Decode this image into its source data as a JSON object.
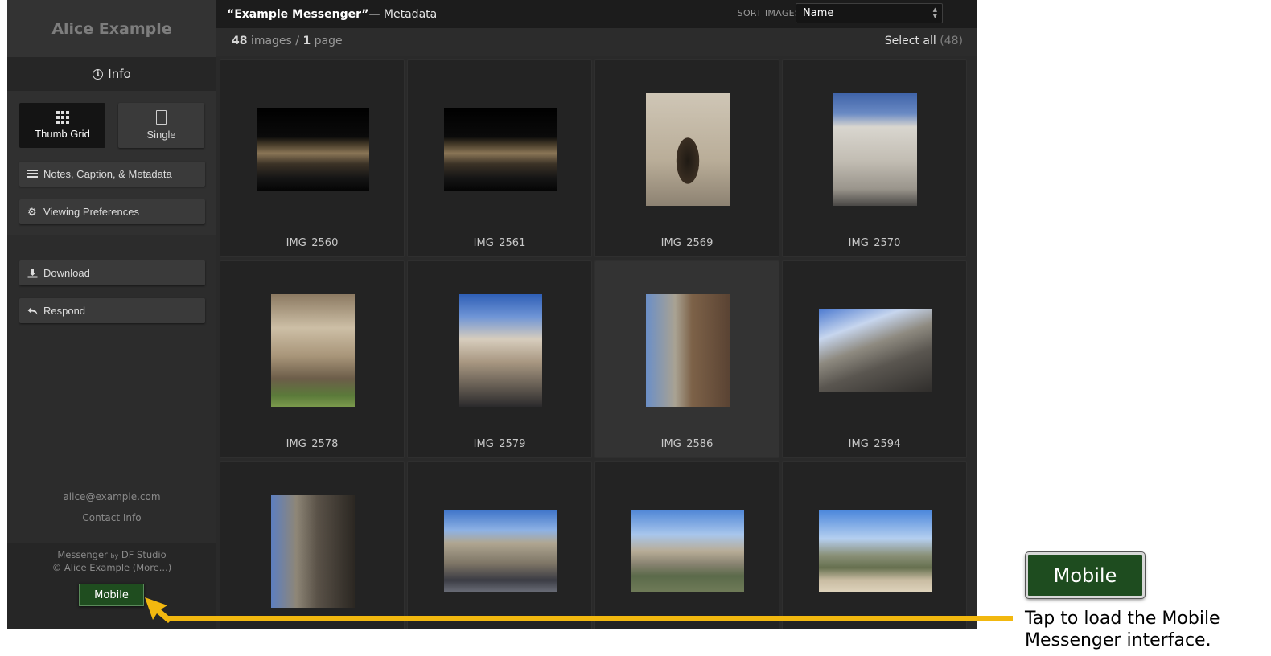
{
  "sidebar": {
    "owner_name": "Alice Example",
    "info_label": "Info",
    "view_thumb_label": "Thumb Grid",
    "view_single_label": "Single",
    "notes_label": "Notes, Caption, & Metadata",
    "prefs_label": "Viewing Preferences",
    "download_label": "Download",
    "respond_label": "Respond",
    "email": "alice@example.com",
    "contact_label": "Contact Info",
    "footer_app": "Messenger",
    "footer_by": "by",
    "footer_brand": "DF Studio",
    "footer_copyright": "© Alice Example (More...)",
    "mobile_label": "Mobile"
  },
  "header": {
    "title": "“Example Messenger”",
    "subtitle": " — Metadata",
    "sort_label": "SORT IMAGES :",
    "sort_value": "Name"
  },
  "counts": {
    "images": "48",
    "images_suffix": " images / ",
    "pages": "1",
    "pages_suffix": " page",
    "select_all": "Select all",
    "select_count": "(48)"
  },
  "images": [
    {
      "name": "IMG_2560"
    },
    {
      "name": "IMG_2561"
    },
    {
      "name": "IMG_2569"
    },
    {
      "name": "IMG_2570"
    },
    {
      "name": "IMG_2578"
    },
    {
      "name": "IMG_2579"
    },
    {
      "name": "IMG_2586"
    },
    {
      "name": "IMG_2594"
    },
    {
      "name": ""
    },
    {
      "name": ""
    },
    {
      "name": ""
    },
    {
      "name": ""
    }
  ],
  "callout": {
    "mobile_label": "Mobile",
    "text": "Tap to load the Mobile Messenger interface.",
    "arrow_color": "#f2b80f"
  },
  "colors": {
    "accent_green": "#1f4d1f",
    "panel_bg": "#2a2a2a"
  }
}
